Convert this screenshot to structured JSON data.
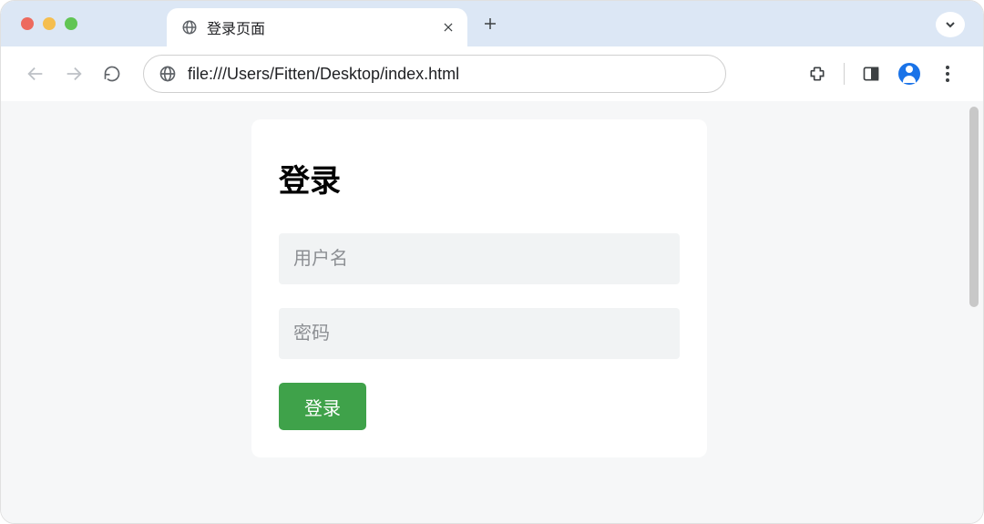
{
  "browser": {
    "tab": {
      "title": "登录页面"
    },
    "address": {
      "url": "file:///Users/Fitten/Desktop/index.html"
    }
  },
  "login": {
    "heading": "登录",
    "username_placeholder": "用户名",
    "password_placeholder": "密码",
    "submit_label": "登录"
  }
}
